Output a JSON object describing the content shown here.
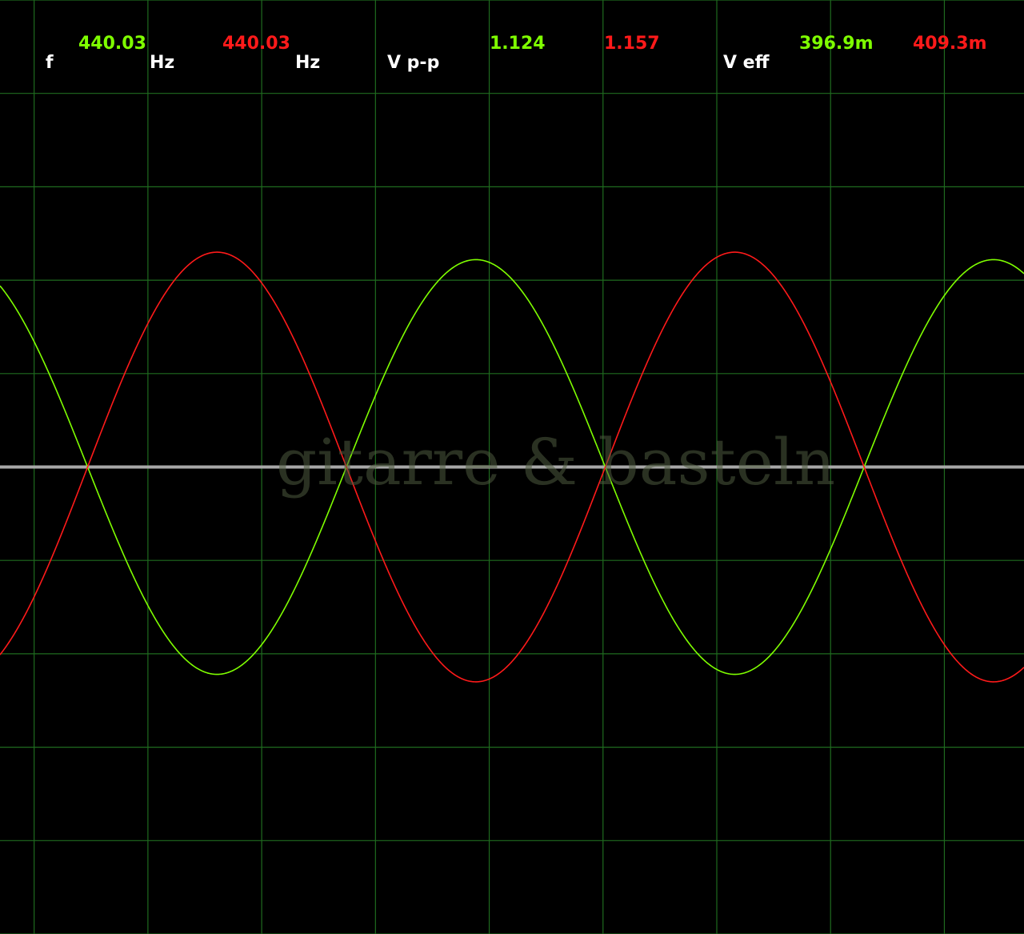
{
  "readouts": {
    "frequency": {
      "label": "f",
      "ch1_value": "440.03",
      "ch1_unit": "Hz",
      "ch2_value": "440.03",
      "ch2_unit": "Hz"
    },
    "peak_to_peak": {
      "label": "V p-p",
      "ch1_value": "1.124",
      "ch2_value": "1.157"
    },
    "rms": {
      "label": "V eff",
      "ch1_value": "396.9m",
      "ch2_value": "409.3m"
    }
  },
  "watermark": "gitarre & basteln",
  "colors": {
    "background": "#000000",
    "grid": "#1f6b1f",
    "ch1_trace": "#7fff00",
    "ch2_trace": "#ff1a1a",
    "baseline": "#a8a8a8",
    "label": "#ffffff"
  },
  "chart_data": {
    "type": "line",
    "title": "",
    "xlabel": "",
    "ylabel": "",
    "grid": true,
    "xlim": [
      -0.3,
      8.7
    ],
    "ylim": [
      -5,
      5
    ],
    "series": [
      {
        "values_formula": "sine",
        "frequency_hz": 440.03,
        "vpp": 1.124,
        "vrms": "396.9m",
        "amplitude_div": 2.22,
        "period_div": 4.55,
        "phase": "negative-going zero crossing at x=0.47 div",
        "color": "#7fff00"
      },
      {
        "values_formula": "sine",
        "frequency_hz": 440.03,
        "vpp": 1.157,
        "vrms": "409.3m",
        "amplitude_div": 2.3,
        "period_div": 4.55,
        "phase": "positive-going zero crossing at x=0.47 div",
        "color": "#ff1a1a"
      }
    ]
  }
}
